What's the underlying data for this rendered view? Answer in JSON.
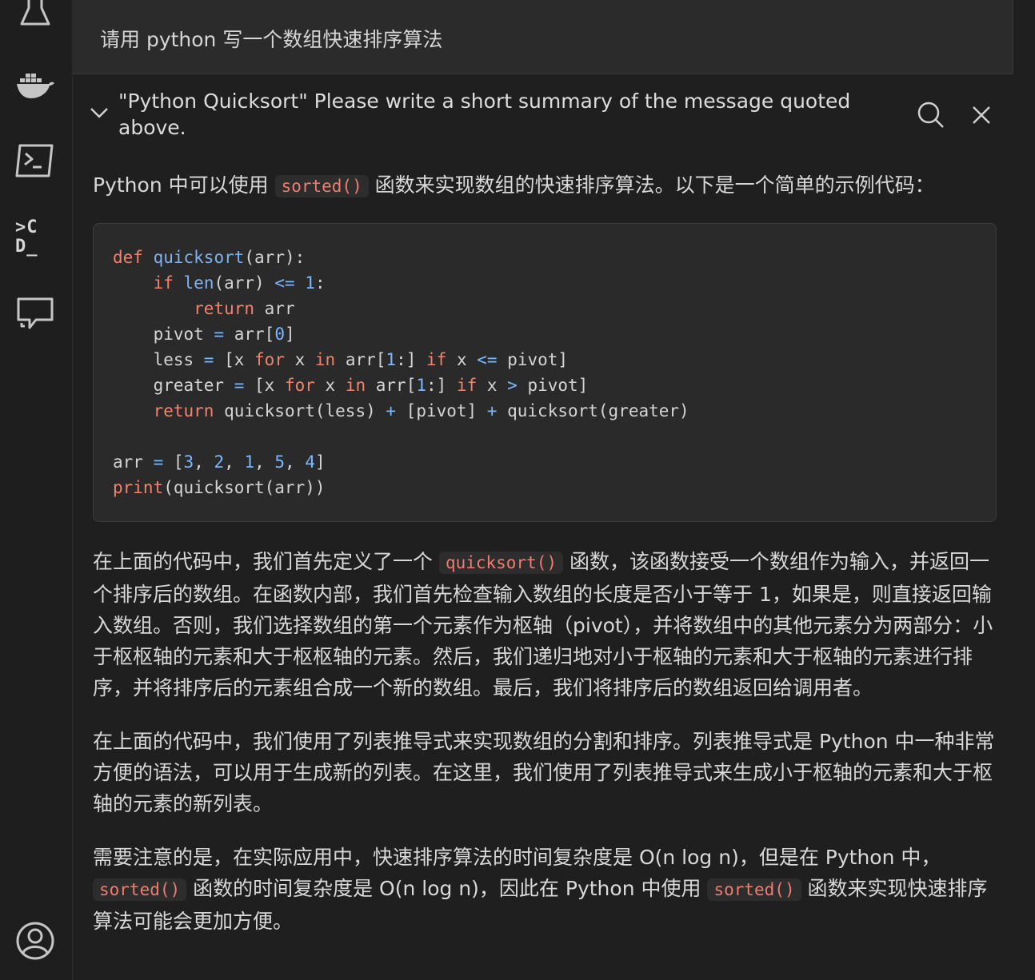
{
  "sidebar": {
    "icons": [
      "flask-icon",
      "docker-icon",
      "terminal-icon",
      "codegpt-icon",
      "chat-icon",
      "account-icon"
    ],
    "codegpt_label_top": ">C",
    "codegpt_label_bottom": "D_"
  },
  "prompt": {
    "text": "请用 python 写一个数组快速排序算法"
  },
  "summary": {
    "text": "\"Python Quicksort\" Please write a short summary of the message quoted above."
  },
  "answer": {
    "intro_before": "Python 中可以使用 ",
    "intro_code": "sorted()",
    "intro_after": " 函数来实现数组的快速排序算法。以下是一个简单的示例代码：",
    "p1_before": "在上面的代码中，我们首先定义了一个 ",
    "p1_code": "quicksort()",
    "p1_after": " 函数，该函数接受一个数组作为输入，并返回一个排序后的数组。在函数内部，我们首先检查输入数组的长度是否小于等于 1，如果是，则直接返回输入数组。否则，我们选择数组的第一个元素作为枢轴（pivot），并将数组中的其他元素分为两部分：小于枢枢轴的元素和大于枢枢轴的元素。然后，我们递归地对小于枢轴的元素和大于枢轴的元素进行排序，并将排序后的元素组合成一个新的数组。最后，我们将排序后的数组返回给调用者。",
    "p2": "在上面的代码中，我们使用了列表推导式来实现数组的分割和排序。列表推导式是 Python 中一种非常方便的语法，可以用于生成新的列表。在这里，我们使用了列表推导式来生成小于枢轴的元素和大于枢轴的元素的新列表。",
    "p3_a": "需要注意的是，在实际应用中，快速排序算法的时间复杂度是 O(n log n)，但是在 Python 中，",
    "p3_code1": "sorted()",
    "p3_b": " 函数的时间复杂度是 O(n log n)，因此在 Python 中使用 ",
    "p3_code2": "sorted()",
    "p3_c": " 函数来实现快速排序算法可能会更加方便。"
  },
  "code": {
    "tokens": [
      {
        "t": "def",
        "c": "kw"
      },
      {
        "t": " "
      },
      {
        "t": "quicksort",
        "c": "fn"
      },
      {
        "t": "(arr):\n    "
      },
      {
        "t": "if",
        "c": "kw"
      },
      {
        "t": " "
      },
      {
        "t": "len",
        "c": "fn"
      },
      {
        "t": "(arr) "
      },
      {
        "t": "<=",
        "c": "op"
      },
      {
        "t": " "
      },
      {
        "t": "1",
        "c": "num"
      },
      {
        "t": ":\n        "
      },
      {
        "t": "return",
        "c": "kw"
      },
      {
        "t": " arr\n    pivot "
      },
      {
        "t": "=",
        "c": "op"
      },
      {
        "t": " arr["
      },
      {
        "t": "0",
        "c": "num"
      },
      {
        "t": "]\n    less "
      },
      {
        "t": "=",
        "c": "op"
      },
      {
        "t": " [x "
      },
      {
        "t": "for",
        "c": "kw"
      },
      {
        "t": " x "
      },
      {
        "t": "in",
        "c": "kw"
      },
      {
        "t": " arr["
      },
      {
        "t": "1",
        "c": "num"
      },
      {
        "t": ":] "
      },
      {
        "t": "if",
        "c": "kw"
      },
      {
        "t": " x "
      },
      {
        "t": "<=",
        "c": "op"
      },
      {
        "t": " pivot]\n    greater "
      },
      {
        "t": "=",
        "c": "op"
      },
      {
        "t": " [x "
      },
      {
        "t": "for",
        "c": "kw"
      },
      {
        "t": " x "
      },
      {
        "t": "in",
        "c": "kw"
      },
      {
        "t": " arr["
      },
      {
        "t": "1",
        "c": "num"
      },
      {
        "t": ":] "
      },
      {
        "t": "if",
        "c": "kw"
      },
      {
        "t": " x "
      },
      {
        "t": ">",
        "c": "op"
      },
      {
        "t": " pivot]\n    "
      },
      {
        "t": "return",
        "c": "kw"
      },
      {
        "t": " quicksort(less) "
      },
      {
        "t": "+",
        "c": "op"
      },
      {
        "t": " [pivot] "
      },
      {
        "t": "+",
        "c": "op"
      },
      {
        "t": " quicksort(greater)\n\narr "
      },
      {
        "t": "=",
        "c": "op"
      },
      {
        "t": " ["
      },
      {
        "t": "3",
        "c": "num"
      },
      {
        "t": ", "
      },
      {
        "t": "2",
        "c": "num"
      },
      {
        "t": ", "
      },
      {
        "t": "1",
        "c": "num"
      },
      {
        "t": ", "
      },
      {
        "t": "5",
        "c": "num"
      },
      {
        "t": ", "
      },
      {
        "t": "4",
        "c": "num"
      },
      {
        "t": "]\n"
      },
      {
        "t": "print",
        "c": "kw"
      },
      {
        "t": "(quicksort(arr))"
      }
    ]
  },
  "colors": {
    "background": "#1f1f1f",
    "keyword": "#f2836b",
    "function": "#7fb2f0",
    "number": "#79b8ff"
  }
}
